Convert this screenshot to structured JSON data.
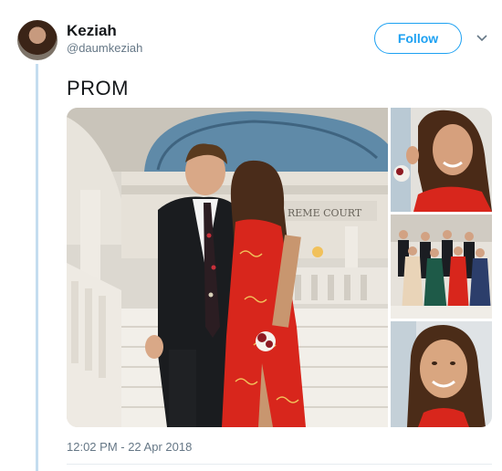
{
  "user": {
    "name": "Keziah",
    "handle": "@daumkeziah"
  },
  "follow_button": {
    "label": "Follow"
  },
  "tweet": {
    "text": "PROM",
    "timestamp": "12:02 PM - 22 Apr 2018"
  },
  "media": {
    "engraving": "REME COURT"
  },
  "colors": {
    "accent": "#1da1f2",
    "thread_line": "#c4ddef",
    "muted": "#657786",
    "dress_red": "#d8261c"
  },
  "icons": {
    "more": "chevron-down-icon"
  }
}
